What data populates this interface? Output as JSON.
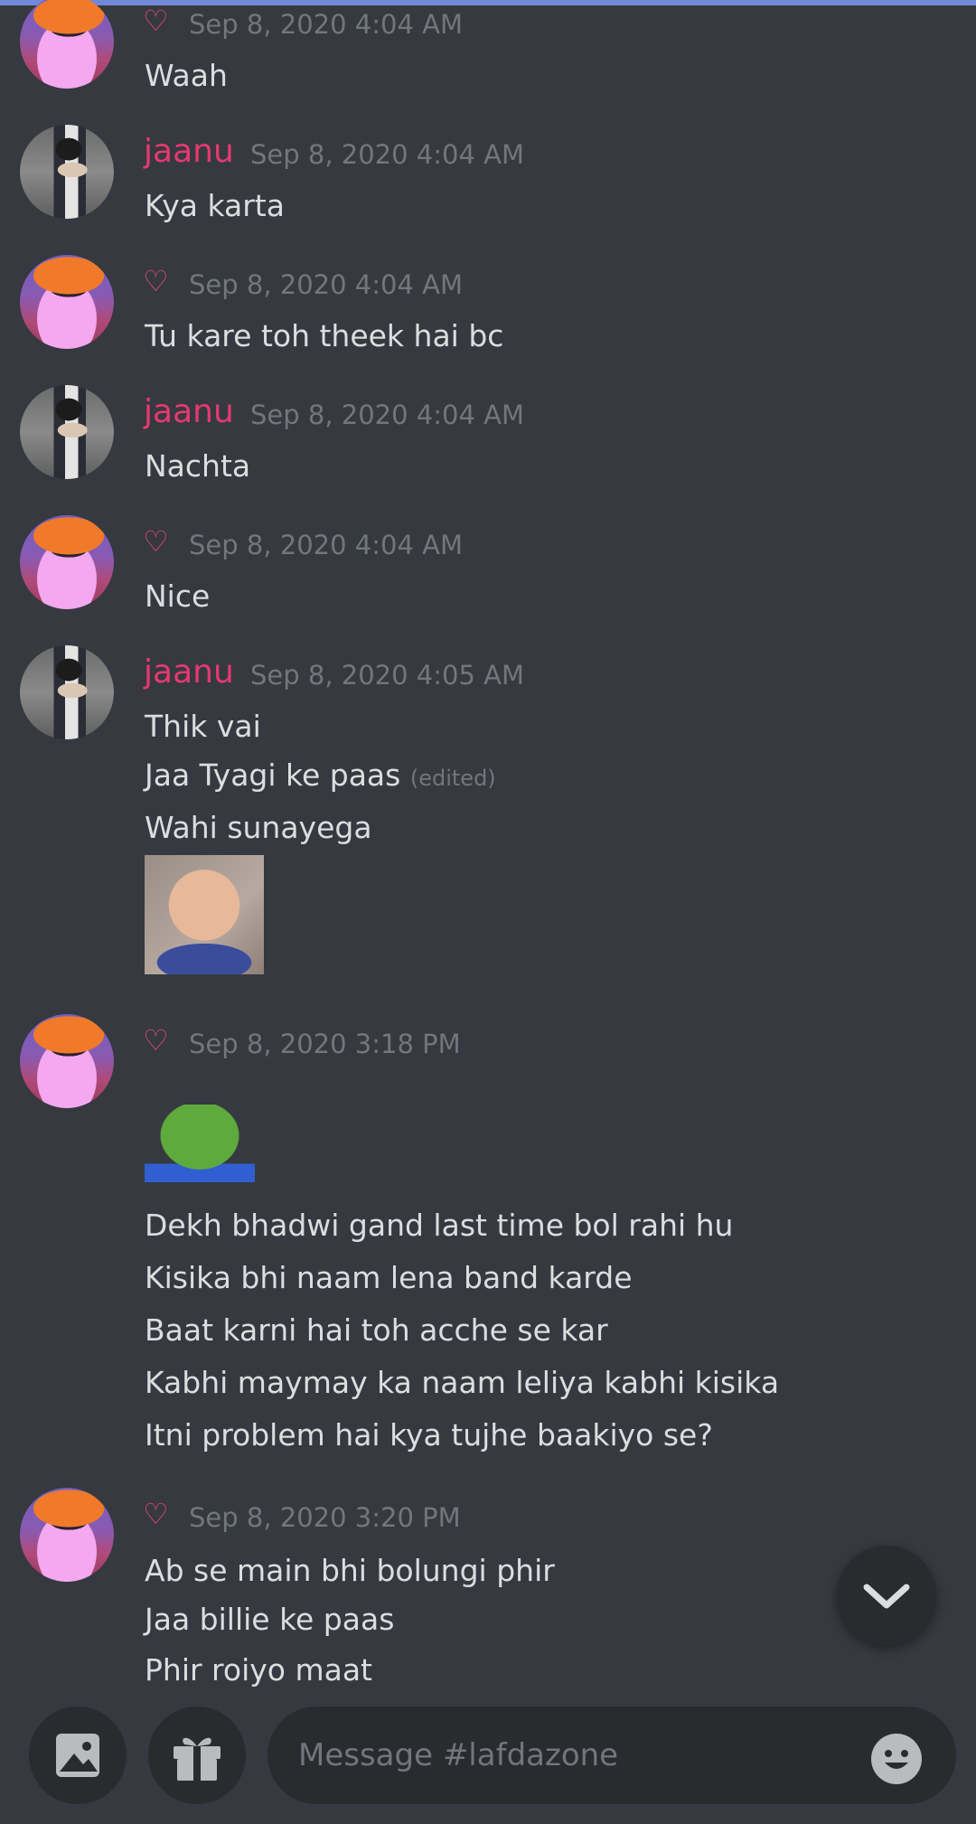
{
  "colors": {
    "background": "#36393f",
    "accent": "#7289da",
    "username": "#e5396f",
    "heart": "#e64a7a",
    "timestamp": "#72767d",
    "message_text": "#dcddde",
    "input_bg": "#292b2f"
  },
  "messages": [
    {
      "author_type": "heart",
      "timestamp": "Sep 8, 2020 4:04 AM",
      "lines": [
        "Waah"
      ]
    },
    {
      "author_type": "jaanu",
      "author": "jaanu",
      "timestamp": "Sep 8, 2020 4:04 AM",
      "lines": [
        "Kya karta"
      ]
    },
    {
      "author_type": "heart",
      "timestamp": "Sep 8, 2020 4:04 AM",
      "lines": [
        "Tu kare toh theek hai bc"
      ]
    },
    {
      "author_type": "jaanu",
      "author": "jaanu",
      "timestamp": "Sep 8, 2020 4:04 AM",
      "lines": [
        "Nachta"
      ]
    },
    {
      "author_type": "heart",
      "timestamp": "Sep 8, 2020 4:04 AM",
      "lines": [
        "Nice"
      ]
    },
    {
      "author_type": "jaanu",
      "author": "jaanu",
      "timestamp": "Sep 8, 2020 4:05 AM",
      "lines": [
        "Thik vai",
        "Jaa Tyagi ke paas",
        "Wahi sunayega"
      ],
      "edited_label": "(edited)"
    },
    {
      "author_type": "heart",
      "timestamp": "Sep 8, 2020 3:18 PM",
      "lines": [
        "Dekh bhadwi gand last time bol rahi hu",
        "Kisika bhi naam lena band karde",
        "Baat karni hai toh acche se kar",
        "Kabhi maymay ka naam leliya kabhi kisika",
        "Itni problem hai kya tujhe baakiyo se?"
      ]
    },
    {
      "author_type": "heart",
      "timestamp": "Sep 8, 2020 3:20 PM",
      "lines": [
        "Ab se main bhi bolungi phir",
        "Jaa billie ke paas",
        "Phir roiyo maat"
      ]
    }
  ],
  "icons": {
    "heart": "heart-outline-icon",
    "scroll_down": "chevron-down-icon",
    "image_upload": "image-icon",
    "gift": "gift-icon",
    "emoji": "smiley-icon"
  },
  "composer": {
    "placeholder": "Message #lafdazone"
  }
}
